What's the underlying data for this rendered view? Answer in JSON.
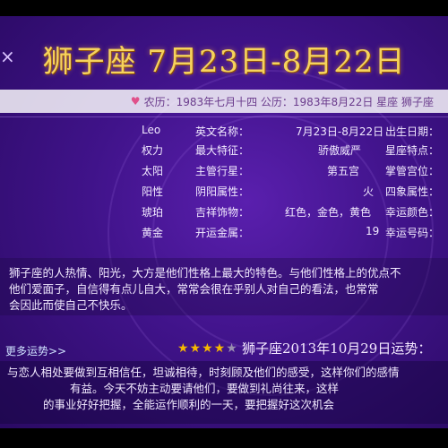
{
  "header": {
    "title": "狮子座 7月23日-8月22日",
    "close_glyph": "×"
  },
  "info_bar": {
    "text": "农历：1983年七月十四 公历：1983年8月22日 星座 狮子座"
  },
  "attributes": [
    {
      "label_left": "英文名称：",
      "value_left": "Leo",
      "label_right": "出生日期：",
      "value_right": "7月23日-8月22日"
    },
    {
      "label_left": "最大特征：",
      "value_left": "权力",
      "label_right": "星座特点：",
      "value_right": "骄傲威严"
    },
    {
      "label_left": "主管行星：",
      "value_left": "太阳",
      "label_right": "掌管宫位：",
      "value_right": "第五宫"
    },
    {
      "label_left": "阴阳属性：",
      "value_left": "阳性",
      "label_right": "四象属性：",
      "value_right": "火"
    },
    {
      "label_left": "吉祥饰物：",
      "value_left": "琥珀",
      "label_right": "幸运颜色：",
      "value_right": "红色，金色，黄色"
    },
    {
      "label_left": "开运金属：",
      "value_left": "黄金",
      "label_right": "幸运号码：",
      "value_right": "19"
    }
  ],
  "description": [
    "狮子座的人热情、阳光，大方是他们性格上最大的特色。与他们性格上的优点不",
    "他们爱面子，自信得有点儿自大，常常会很在乎别人对自己的看法，也常常",
    "会因此而使自己不快乐。"
  ],
  "more_link": "更多运势>>",
  "fortune": {
    "title": "狮子座2013年10月29日运势：",
    "rating_stars": "★★★★",
    "rating_empty": "★",
    "lines": [
      "与恋人相处要做到互相信任，坦诚相待，时刻顾及他们的感受，这样你们的感情",
      "有益。今天不妨主动要请他们，要做到礼尚往来，这样",
      "的事业好好把握，全能运作顺利的一天，要把握好这次机会"
    ]
  },
  "colors": {
    "title": "#f6d35c",
    "star": "#f6b800",
    "background": "#40138a"
  }
}
